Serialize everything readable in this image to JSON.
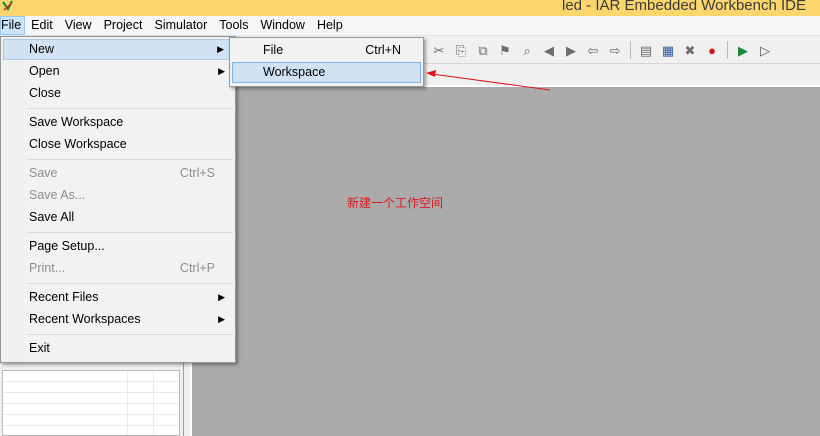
{
  "window": {
    "title": "led - IAR Embedded Workbench IDE"
  },
  "menubar": {
    "items": [
      {
        "label": "File",
        "active": true
      },
      {
        "label": "Edit"
      },
      {
        "label": "View"
      },
      {
        "label": "Project"
      },
      {
        "label": "Simulator"
      },
      {
        "label": "Tools"
      },
      {
        "label": "Window"
      },
      {
        "label": "Help"
      }
    ]
  },
  "file_menu": {
    "items": [
      {
        "label": "New",
        "submenu": true,
        "highlighted": true
      },
      {
        "label": "Open",
        "submenu": true
      },
      {
        "label": "Close"
      },
      {
        "label": "Save Workspace"
      },
      {
        "label": "Close Workspace"
      },
      {
        "label": "Save",
        "shortcut": "Ctrl+S",
        "disabled": true
      },
      {
        "label": "Save As...",
        "disabled": true
      },
      {
        "label": "Save All"
      },
      {
        "label": "Page Setup..."
      },
      {
        "label": "Print...",
        "shortcut": "Ctrl+P",
        "disabled": true
      },
      {
        "label": "Recent Files",
        "submenu": true
      },
      {
        "label": "Recent Workspaces",
        "submenu": true
      },
      {
        "label": "Exit"
      }
    ]
  },
  "new_submenu": {
    "items": [
      {
        "label": "File",
        "shortcut": "Ctrl+N"
      },
      {
        "label": "Workspace",
        "highlighted": true
      }
    ]
  },
  "annotation": {
    "text": "新建一个工作空间",
    "color": "#e0141e"
  },
  "colors": {
    "titlebar": "#fbd66c",
    "editor_background": "#ababab",
    "menu_highlight": "#d1e2f2"
  },
  "toolbar": {
    "icons": [
      "cut-icon",
      "copy-icon",
      "paste-icon",
      "bookmark-icon",
      "find-icon",
      "prev-bookmark-icon",
      "next-bookmark-icon",
      "go-back-icon",
      "go-forward-icon",
      "toggle-breakpoint-icon",
      "compile-icon",
      "make-icon",
      "stop-build-icon",
      "debug-icon",
      "download-debug-icon"
    ]
  }
}
